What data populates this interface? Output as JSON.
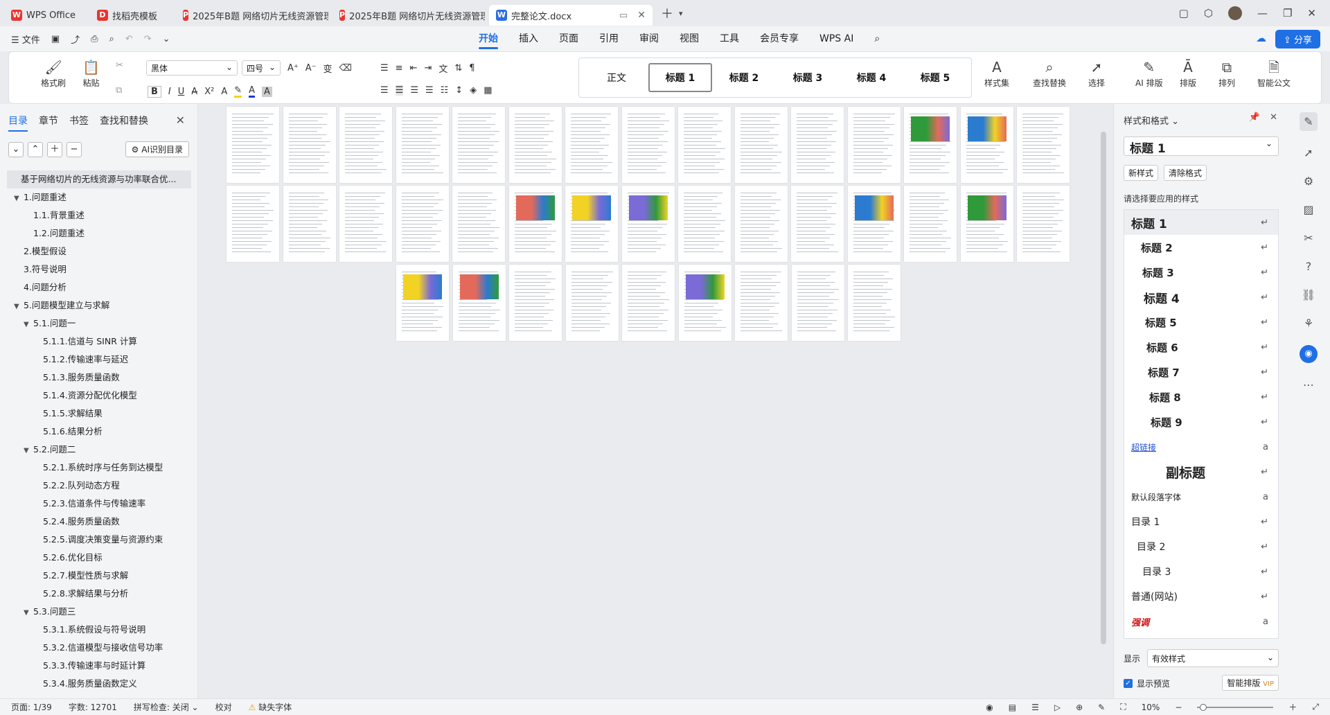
{
  "tabs": [
    {
      "label": "WPS Office",
      "icon": "wps-logo-icon",
      "color": "#e8352e"
    },
    {
      "label": "找稻壳模板",
      "icon": "docer-icon",
      "color": "#e8352e"
    },
    {
      "label": "2025年B题 网络切片无线资源管理方",
      "icon": "pdf-icon",
      "color": "#e8352e"
    },
    {
      "label": "2025年B题 网络切片无线资源管理方",
      "icon": "pdf-icon",
      "color": "#e8352e"
    },
    {
      "label": "完整论文.docx",
      "icon": "word-icon",
      "color": "#2b6fe0"
    }
  ],
  "menu": {
    "file_label": "文件",
    "tabs": [
      "开始",
      "插入",
      "页面",
      "引用",
      "审阅",
      "视图",
      "工具",
      "会员专享",
      "WPS AI"
    ],
    "active_tab": "开始",
    "share_label": "分享"
  },
  "ribbon": {
    "format_painter": "格式刷",
    "paste": "粘贴",
    "font_name": "黑体",
    "font_size": "四号",
    "styles": [
      "正文",
      "标题 1",
      "标题 2",
      "标题 3",
      "标题 4",
      "标题 5"
    ],
    "selected_style": "标题 1",
    "style_set": "样式集",
    "find_replace": "查找替换",
    "select": "选择",
    "ai_layout": "AI 排版",
    "layout": "排版",
    "arrange": "排列",
    "smart_doc": "智能公文"
  },
  "left_panel": {
    "tabs": [
      "目录",
      "章节",
      "书签",
      "查找和替换"
    ],
    "active_tab": "目录",
    "ai_toc_label": "AI识别目录",
    "toc": [
      {
        "level": 0,
        "text": "基于网络切片的无线资源与功率联合优...",
        "highlight": true
      },
      {
        "level": 1,
        "text": "1.问题重述",
        "arrow": "▼"
      },
      {
        "level": 2,
        "text": "1.1.背景重述"
      },
      {
        "level": 2,
        "text": "1.2.问题重述"
      },
      {
        "level": 1,
        "text": "2.模型假设"
      },
      {
        "level": 1,
        "text": "3.符号说明"
      },
      {
        "level": 1,
        "text": "4.问题分析"
      },
      {
        "level": 1,
        "text": "5.问题模型建立与求解",
        "arrow": "▼"
      },
      {
        "level": 2,
        "text": "5.1.问题一",
        "arrow": "▼"
      },
      {
        "level": 3,
        "text": "5.1.1.信道与 SINR 计算"
      },
      {
        "level": 3,
        "text": "5.1.2.传输速率与延迟"
      },
      {
        "level": 3,
        "text": "5.1.3.服务质量函数"
      },
      {
        "level": 3,
        "text": "5.1.4.资源分配优化模型"
      },
      {
        "level": 3,
        "text": "5.1.5.求解结果"
      },
      {
        "level": 3,
        "text": "5.1.6.结果分析"
      },
      {
        "level": 2,
        "text": "5.2.问题二",
        "arrow": "▼"
      },
      {
        "level": 3,
        "text": "5.2.1.系统时序与任务到达模型"
      },
      {
        "level": 3,
        "text": "5.2.2.队列动态方程"
      },
      {
        "level": 3,
        "text": "5.2.3.信道条件与传输速率"
      },
      {
        "level": 3,
        "text": "5.2.4.服务质量函数"
      },
      {
        "level": 3,
        "text": "5.2.5.调度决策变量与资源约束"
      },
      {
        "level": 3,
        "text": "5.2.6.优化目标"
      },
      {
        "level": 3,
        "text": "5.2.7.模型性质与求解"
      },
      {
        "level": 3,
        "text": "5.2.8.求解结果与分析"
      },
      {
        "level": 2,
        "text": "5.3.问题三",
        "arrow": "▼"
      },
      {
        "level": 3,
        "text": "5.3.1.系统假设与符号说明"
      },
      {
        "level": 3,
        "text": "5.3.2.信道模型与接收信号功率"
      },
      {
        "level": 3,
        "text": "5.3.3.传输速率与时延计算"
      },
      {
        "level": 3,
        "text": "5.3.4.服务质量函数定义"
      }
    ]
  },
  "right_panel": {
    "title": "样式和格式",
    "current_style": "标题 1",
    "new_style": "新样式",
    "clear_format": "清除格式",
    "apply_label": "请选择要应用的样式",
    "styles": [
      {
        "label": "标题 1",
        "mark": "↵"
      },
      {
        "label": "标题 2",
        "mark": "↵"
      },
      {
        "label": "标题 3",
        "mark": "↵"
      },
      {
        "label": "标题 4",
        "mark": "↵"
      },
      {
        "label": "标题 5",
        "mark": "↵"
      },
      {
        "label": "标题 6",
        "mark": "↵"
      },
      {
        "label": "标题 7",
        "mark": "↵"
      },
      {
        "label": "标题 8",
        "mark": "↵"
      },
      {
        "label": "标题 9",
        "mark": "↵"
      },
      {
        "label": "超链接",
        "mark": "a"
      },
      {
        "label": "副标题",
        "mark": "↵"
      },
      {
        "label": "默认段落字体",
        "mark": "a"
      },
      {
        "label": "目录 1",
        "mark": "↵"
      },
      {
        "label": "目录 2",
        "mark": "↵"
      },
      {
        "label": "目录 3",
        "mark": "↵"
      },
      {
        "label": "普通(网站)",
        "mark": "↵"
      },
      {
        "label": "强调",
        "mark": "a"
      }
    ],
    "show_label": "显示",
    "show_value": "有效样式",
    "preview_label": "显示预览",
    "smart_layout": "智能排版"
  },
  "status": {
    "page": "页面: 1/39",
    "words": "字数: 12701",
    "spell": "拼写检查: 关闭",
    "proof": "校对",
    "missing_font": "缺失字体",
    "zoom": "10%"
  }
}
